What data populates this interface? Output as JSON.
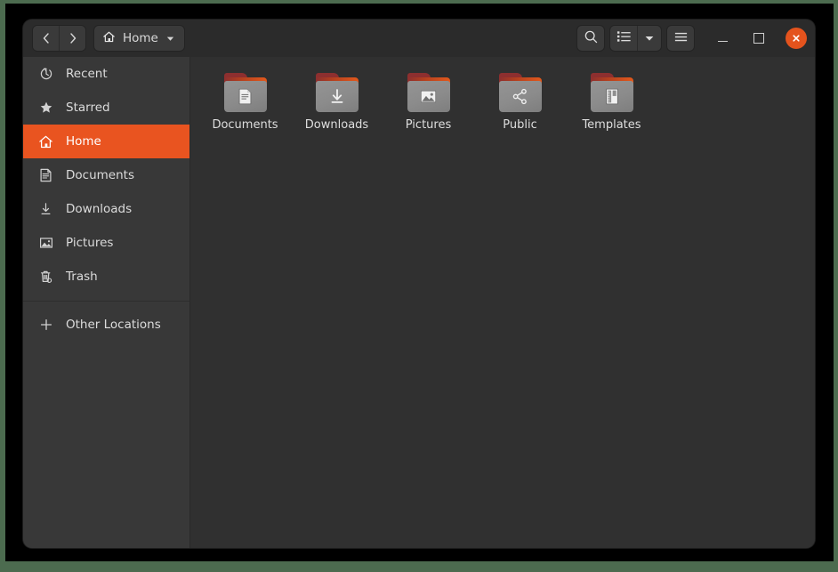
{
  "window": {
    "title": "Home",
    "accent_color": "#e95420",
    "close_button_color": "#e4531d",
    "background_color": "#303030",
    "sidebar_color": "#383838",
    "header_color": "#2b2b2b"
  },
  "header": {
    "back_label": "Back",
    "forward_label": "Forward",
    "path_label": "Home",
    "path_icon": "home-icon",
    "path_dropdown_icon": "chevron-down-icon",
    "search_label": "Search",
    "view_list_label": "List view",
    "view_options_label": "View options",
    "menu_label": "Main menu",
    "minimize_label": "Minimize",
    "maximize_label": "Maximize",
    "close_label": "Close"
  },
  "sidebar": {
    "items": [
      {
        "label": "Recent",
        "icon": "clock-icon",
        "selected": false
      },
      {
        "label": "Starred",
        "icon": "star-icon",
        "selected": false
      },
      {
        "label": "Home",
        "icon": "home-icon",
        "selected": true
      },
      {
        "label": "Documents",
        "icon": "document-icon",
        "selected": false
      },
      {
        "label": "Downloads",
        "icon": "download-icon",
        "selected": false
      },
      {
        "label": "Pictures",
        "icon": "image-icon",
        "selected": false
      },
      {
        "label": "Trash",
        "icon": "trash-icon",
        "selected": false
      }
    ],
    "other_locations": {
      "label": "Other Locations",
      "icon": "plus-icon"
    }
  },
  "main": {
    "files": [
      {
        "name": "Documents",
        "emblem": "document-icon"
      },
      {
        "name": "Downloads",
        "emblem": "download-icon"
      },
      {
        "name": "Pictures",
        "emblem": "image-icon"
      },
      {
        "name": "Public",
        "emblem": "share-icon"
      },
      {
        "name": "Templates",
        "emblem": "template-icon"
      }
    ]
  }
}
